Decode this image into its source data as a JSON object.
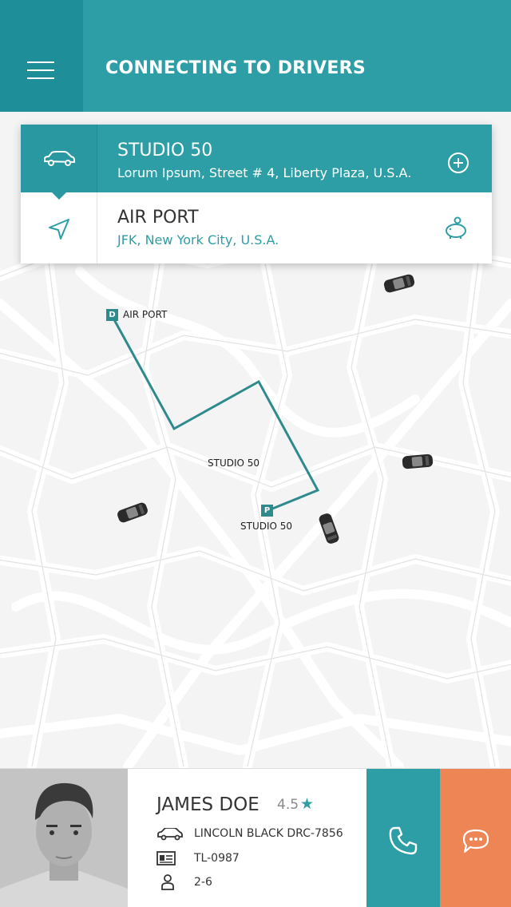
{
  "header": {
    "title": "CONNECTING TO DRIVERS"
  },
  "route": {
    "from": {
      "name": "STUDIO 50",
      "address": "Lorum Ipsum, Street # 4, Liberty Plaza, U.S.A."
    },
    "to": {
      "name": "AIR PORT",
      "address": "JFK, New York City, U.S.A."
    }
  },
  "map": {
    "destination_pin": "D",
    "destination_label": "AIR PORT",
    "pickup_pin": "P",
    "pickup_label": "STUDIO 50",
    "area_label": "STUDIO 50"
  },
  "driver": {
    "name": "JAMES DOE",
    "rating": "4.5",
    "vehicle": "LINCOLN BLACK DRC-7856",
    "license": "TL-0987",
    "capacity": "2-6"
  },
  "colors": {
    "primary": "#2d9ea6",
    "accent": "#ee8554",
    "route": "#2e8a8d"
  },
  "icons": {
    "menu": "hamburger-icon",
    "from": "car-icon",
    "to": "navigation-arrow-icon",
    "add": "plus-circle-icon",
    "fare": "piggy-bank-icon",
    "star": "star-icon",
    "call": "phone-icon",
    "chat": "chat-icon"
  }
}
